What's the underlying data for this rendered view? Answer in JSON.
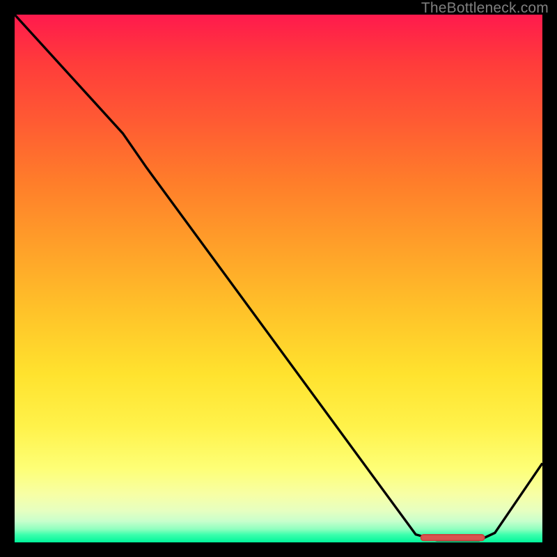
{
  "attribution": "TheBottleneck.com",
  "colors": {
    "curve_stroke": "#000000",
    "marker_fill": "#d9534f",
    "marker_stroke": "#c94540",
    "frame_border": "#000000",
    "gradient_top": "#ff1a4d",
    "gradient_bottom": "#00f59b"
  },
  "chart_data": {
    "type": "line",
    "title": "",
    "xlabel": "",
    "ylabel": "",
    "xlim": [
      0,
      100
    ],
    "ylim": [
      0,
      100
    ],
    "series": [
      {
        "name": "curve",
        "points": [
          {
            "x": 0.0,
            "y": 100.0
          },
          {
            "x": 20.5,
            "y": 77.5
          },
          {
            "x": 25.0,
            "y": 71.0
          },
          {
            "x": 76.0,
            "y": 1.5
          },
          {
            "x": 80.0,
            "y": 0.4
          },
          {
            "x": 88.0,
            "y": 0.4
          },
          {
            "x": 91.0,
            "y": 1.8
          },
          {
            "x": 100.0,
            "y": 15.0
          }
        ]
      }
    ],
    "annotations": [
      {
        "name": "optimum-marker",
        "x_start": 77.0,
        "x_end": 89.0,
        "y": 0.9
      }
    ]
  }
}
